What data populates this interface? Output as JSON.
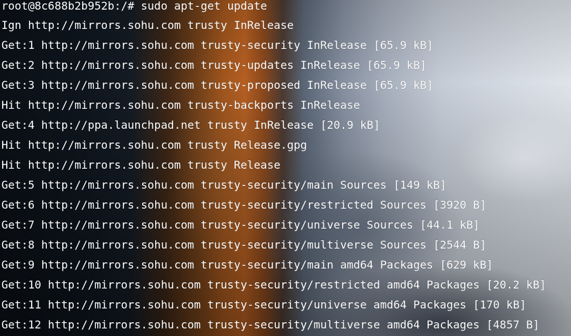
{
  "terminal": {
    "prompt": "root@8c688b2b952b:/# sudo apt-get update",
    "lines": [
      "Ign http://mirrors.sohu.com trusty InRelease",
      "Get:1 http://mirrors.sohu.com trusty-security InRelease [65.9 kB]",
      "Get:2 http://mirrors.sohu.com trusty-updates InRelease [65.9 kB]",
      "Get:3 http://mirrors.sohu.com trusty-proposed InRelease [65.9 kB]",
      "Hit http://mirrors.sohu.com trusty-backports InRelease",
      "Get:4 http://ppa.launchpad.net trusty InRelease [20.9 kB]",
      "Hit http://mirrors.sohu.com trusty Release.gpg",
      "Hit http://mirrors.sohu.com trusty Release",
      "Get:5 http://mirrors.sohu.com trusty-security/main Sources [149 kB]",
      "Get:6 http://mirrors.sohu.com trusty-security/restricted Sources [3920 B]",
      "Get:7 http://mirrors.sohu.com trusty-security/universe Sources [44.1 kB]",
      "Get:8 http://mirrors.sohu.com trusty-security/multiverse Sources [2544 B]",
      "Get:9 http://mirrors.sohu.com trusty-security/main amd64 Packages [629 kB]",
      "Get:10 http://mirrors.sohu.com trusty-security/restricted amd64 Packages [20.2 kB]",
      "Get:11 http://mirrors.sohu.com trusty-security/universe amd64 Packages [170 kB]",
      "Get:12 http://mirrors.sohu.com trusty-security/multiverse amd64 Packages [4857 B]"
    ]
  }
}
